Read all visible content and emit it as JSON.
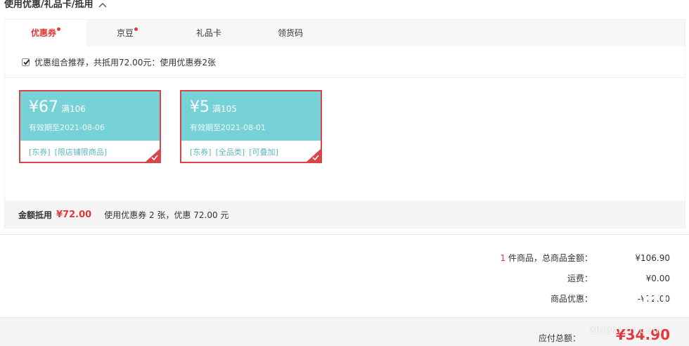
{
  "section": {
    "title": "使用优惠/礼品卡/抵用"
  },
  "tabs": [
    {
      "label": "优惠券",
      "active": true,
      "dot": true
    },
    {
      "label": "京豆",
      "active": false,
      "dot": true
    },
    {
      "label": "礼品卡",
      "active": false,
      "dot": false
    },
    {
      "label": "领货码",
      "active": false,
      "dot": false
    }
  ],
  "combo": {
    "checked": true,
    "text": "优惠组合推荐，共抵用72.00元：使用优惠券2张"
  },
  "coupons": [
    {
      "symbol": "¥",
      "amount": "67",
      "condition": "满106",
      "validity": "有效期至2021-08-06",
      "tags": [
        "[东券]",
        "[限店铺限商品]"
      ],
      "selected": true
    },
    {
      "symbol": "¥",
      "amount": "5",
      "condition": "满105",
      "validity": "有效期至2021-08-01",
      "tags": [
        "[东券]",
        "[全品类]",
        "[可叠加]"
      ],
      "selected": true
    }
  ],
  "summary": {
    "label": "金额抵用",
    "amount": "¥72.00",
    "detail": "使用优惠券 2 张，优惠 72.00 元"
  },
  "totals": {
    "items_count": "1",
    "items_label": " 件商品，总商品金额：",
    "items_value": "¥106.90",
    "shipping_label": "运费：",
    "shipping_value": "¥0.00",
    "discount_label": "商品优惠：",
    "discount_value": "-¥72.00",
    "pay_label": "应付总额：",
    "pay_value": "¥34.90"
  },
  "watermark": {
    "text": "zhizhi.bi.com"
  },
  "colors": {
    "accent": "#e4393c",
    "coupon_bg": "#76d2d6",
    "coupon_border": "#d9464a",
    "tag_text": "#5ab8be"
  }
}
